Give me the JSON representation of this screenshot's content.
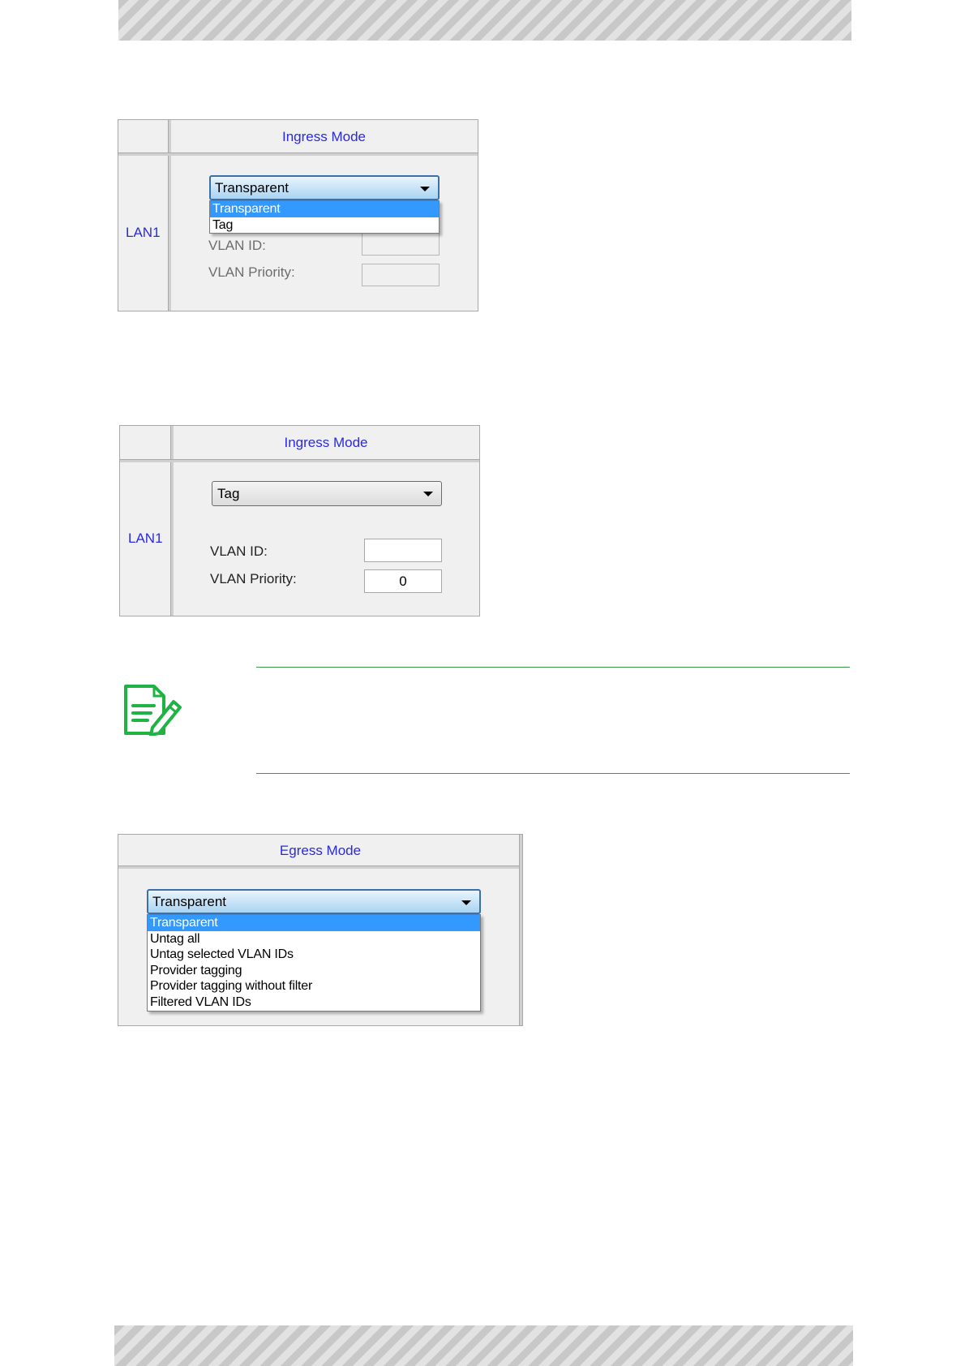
{
  "colors": {
    "header_text": "#2a2adf",
    "accent_green": "#1fb344",
    "selection": "#3399ff"
  },
  "panel1": {
    "header": "Ingress Mode",
    "row_label": "LAN1",
    "select_value": "Transparent",
    "options": [
      "Transparent",
      "Tag"
    ],
    "selected_option": "Transparent",
    "vlan_id_label": "VLAN ID:",
    "vlan_priority_label": "VLAN Priority:",
    "vlan_id_value": "",
    "vlan_priority_value": ""
  },
  "panel2": {
    "header": "Ingress Mode",
    "row_label": "LAN1",
    "select_value": "Tag",
    "vlan_id_label": "VLAN ID:",
    "vlan_priority_label": "VLAN Priority:",
    "vlan_id_value": "",
    "vlan_priority_value": "0"
  },
  "note": {
    "icon": "note-pencil-icon"
  },
  "panel3": {
    "header": "Egress Mode",
    "select_value": "Transparent",
    "options": [
      "Transparent",
      "Untag all",
      "Untag selected VLAN IDs",
      "Provider tagging",
      "Provider tagging without filter",
      "Filtered VLAN IDs"
    ],
    "selected_option": "Transparent"
  }
}
